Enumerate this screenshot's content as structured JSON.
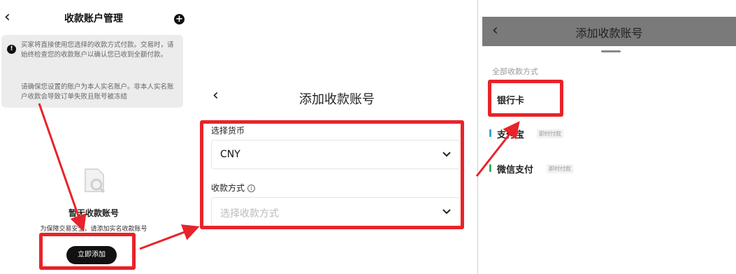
{
  "panel1": {
    "title": "收款账户管理",
    "notice_line1": "买家将直接使用您选择的收款方式付款。交易时，请始终检查您的收款账户以确认您已收到全额付款。",
    "notice_line2": "请确保您设置的账户为本人实名账户。非本人实名账户收款会导致订单失败且账号被冻结",
    "empty_title": "暂无收款账号",
    "empty_subtitle": "为保障交易安全，请添加实名收款账号",
    "add_button": "立即添加"
  },
  "panel2": {
    "title": "添加收款账号",
    "currency_label": "选择货币",
    "currency_value": "CNY",
    "method_label": "收款方式",
    "method_placeholder": "选择收款方式"
  },
  "panel3": {
    "title": "添加收款账号",
    "section_label": "全部收款方式",
    "methods": [
      {
        "label": "银行卡",
        "tag": "",
        "color": "#e0a030"
      },
      {
        "label": "支付宝",
        "tag": "即时付款",
        "color": "#3aa3d8"
      },
      {
        "label": "微信支付",
        "tag": "即时付款",
        "color": "#2fb36b"
      }
    ]
  },
  "colors": {
    "highlight": "#e8232a",
    "header_gray": "#7a7a7a"
  }
}
